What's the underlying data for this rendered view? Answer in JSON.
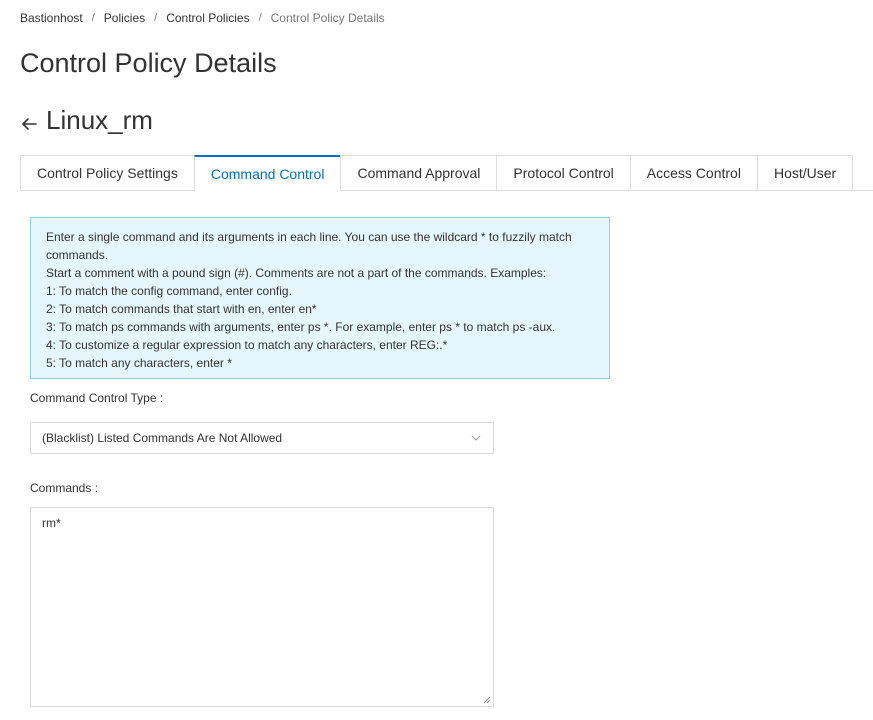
{
  "breadcrumb": {
    "items": [
      "Bastionhost",
      "Policies",
      "Control Policies"
    ],
    "current": "Control Policy Details",
    "separator": "/"
  },
  "page": {
    "title": "Control Policy Details",
    "policy_name": "Linux_rm"
  },
  "tabs": [
    {
      "label": "Control Policy Settings",
      "active": false
    },
    {
      "label": "Command Control",
      "active": true
    },
    {
      "label": "Command Approval",
      "active": false
    },
    {
      "label": "Protocol Control",
      "active": false
    },
    {
      "label": "Access Control",
      "active": false
    },
    {
      "label": "Host/User",
      "active": false
    }
  ],
  "info": {
    "lines": [
      "Enter a single command and its arguments in each line. You can use the wildcard * to fuzzily match commands.",
      "Start a comment with a pound sign (#). Comments are not a part of the commands. Examples:",
      "1: To match the config command, enter config.",
      "2: To match commands that start with en, enter en*",
      "3: To match ps commands with arguments, enter ps *. For example, enter ps * to match ps -aux.",
      "4: To customize a regular expression to match any characters, enter REG:.*",
      "5: To match any characters, enter *"
    ]
  },
  "form": {
    "control_type_label": "Command Control Type :",
    "control_type_value": "(Blacklist) Listed Commands Are Not Allowed",
    "commands_label": "Commands :",
    "commands_value": "rm*"
  },
  "icons": {
    "back": "arrow-left-icon",
    "select": "chevron-down-icon",
    "resize": "resize-handle-icon"
  },
  "colors": {
    "accent": "#0070cc",
    "info_bg": "#e5f7fc",
    "info_border": "#88d4e8"
  }
}
